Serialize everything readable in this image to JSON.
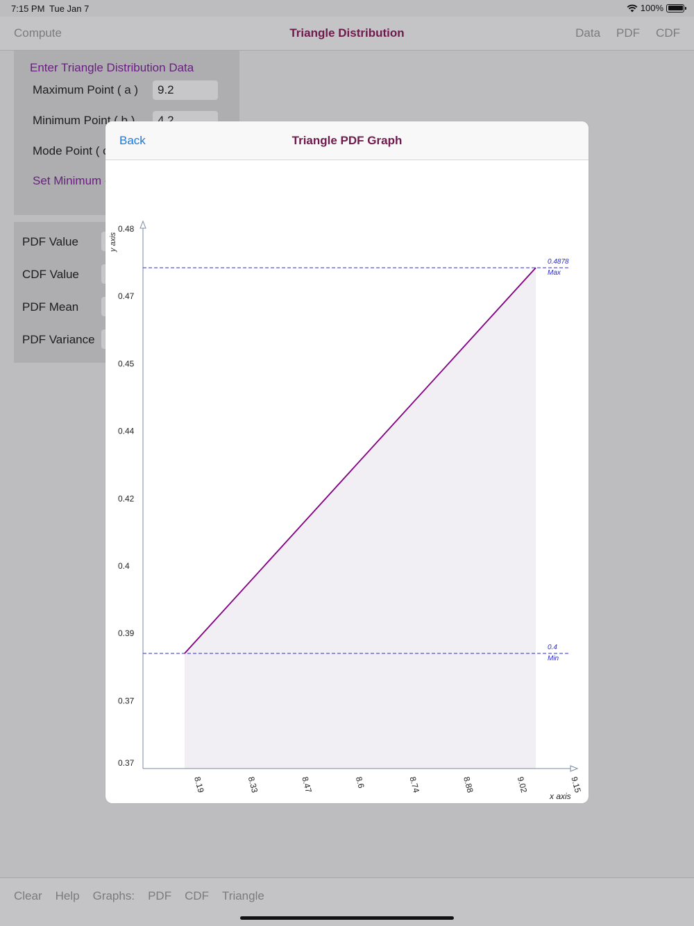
{
  "status": {
    "time": "7:15 PM",
    "date": "Tue Jan 7",
    "battery": "100%"
  },
  "nav": {
    "left": "Compute",
    "title": "Triangle Distribution",
    "right": [
      "Data",
      "PDF",
      "CDF"
    ]
  },
  "form": {
    "header": "Enter Triangle Distribution Data",
    "rows": [
      {
        "label": "Maximum Point ( a )",
        "value": "9.2"
      },
      {
        "label": "Minimum Point ( b )",
        "value": "4.2"
      },
      {
        "label": "Mode Point ( c )",
        "value": ""
      }
    ],
    "set_minimum": "Set Minimum -"
  },
  "results": {
    "rows": [
      "PDF Value",
      "CDF Value",
      "PDF Mean",
      "PDF Variance"
    ]
  },
  "toolbar": {
    "items": [
      "Clear",
      "Help",
      "Graphs:",
      "PDF",
      "CDF",
      "Triangle"
    ]
  },
  "modal": {
    "back": "Back",
    "title": "Triangle PDF Graph"
  },
  "colors": {
    "line": "#800080",
    "fill": "#f1eef4",
    "guide": "#2a2ad8",
    "axis": "#7a8aa0",
    "title": "#6e1a4c",
    "back": "#1a78e0"
  },
  "chart_data": {
    "type": "line",
    "title": "Triangle PDF Graph",
    "xlabel": "x axis",
    "ylabel": "y axis",
    "x_ticks": [
      "8.19",
      "8.33",
      "8.47",
      "8.6",
      "8.74",
      "8.88",
      "9.02",
      "9.15"
    ],
    "y_ticks": [
      "0.48",
      "0.47",
      "0.45",
      "0.44",
      "0.42",
      "0.4",
      "0.39",
      "0.37",
      "0.37"
    ],
    "series": [
      {
        "points": [
          {
            "x": 8.19,
            "y": 0.4
          },
          {
            "x": 9.2,
            "y": 0.4878
          }
        ]
      }
    ],
    "guides": [
      {
        "value": "0.4878",
        "label": "Max",
        "y": 0.4878
      },
      {
        "value": "0.4",
        "label": "Min",
        "y": 0.4
      }
    ]
  }
}
